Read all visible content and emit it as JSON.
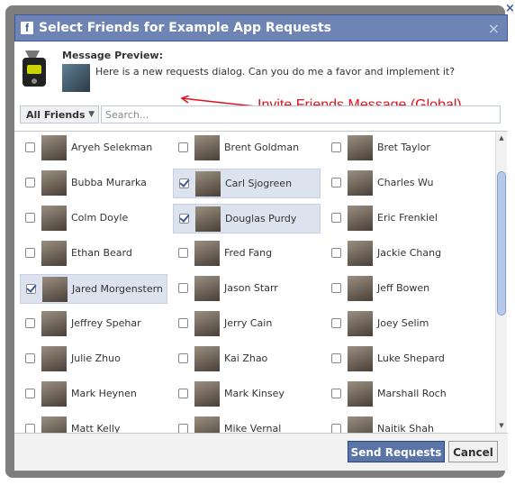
{
  "dialog": {
    "title": "Select Friends for Example App Requests",
    "logo_letter": "f",
    "close_symbol": "×",
    "corner_close_symbol": "×"
  },
  "preview": {
    "label": "Message Preview:",
    "message": "Here is a new requests dialog. Can you do me a favor and implement it?"
  },
  "annotation": {
    "text": "Invite Friends Message (Global)",
    "color": "#e0121a"
  },
  "filter": {
    "selected": "All Friends",
    "search_placeholder": "Search..."
  },
  "friends": [
    {
      "name": "Aryeh Selekman",
      "checked": false
    },
    {
      "name": "Brent Goldman",
      "checked": false
    },
    {
      "name": "Bret Taylor",
      "checked": false
    },
    {
      "name": "Bubba Murarka",
      "checked": false
    },
    {
      "name": "Carl Sjogreen",
      "checked": true
    },
    {
      "name": "Charles Wu",
      "checked": false
    },
    {
      "name": "Colm Doyle",
      "checked": false
    },
    {
      "name": "Douglas Purdy",
      "checked": true
    },
    {
      "name": "Eric Frenkiel",
      "checked": false
    },
    {
      "name": "Ethan Beard",
      "checked": false
    },
    {
      "name": "Fred Fang",
      "checked": false
    },
    {
      "name": "Jackie Chang",
      "checked": false
    },
    {
      "name": "Jared Morgenstern",
      "checked": true
    },
    {
      "name": "Jason Starr",
      "checked": false
    },
    {
      "name": "Jeff Bowen",
      "checked": false
    },
    {
      "name": "Jeffrey Spehar",
      "checked": false
    },
    {
      "name": "Jerry Cain",
      "checked": false
    },
    {
      "name": "Joey Selim",
      "checked": false
    },
    {
      "name": "Julie Zhuo",
      "checked": false
    },
    {
      "name": "Kai Zhao",
      "checked": false
    },
    {
      "name": "Luke Shepard",
      "checked": false
    },
    {
      "name": "Mark Heynen",
      "checked": false
    },
    {
      "name": "Mark Kinsey",
      "checked": false
    },
    {
      "name": "Marshall Roch",
      "checked": false
    },
    {
      "name": "Matt Kelly",
      "checked": false
    },
    {
      "name": "Mike Vernal",
      "checked": false
    },
    {
      "name": "Naitik Shah",
      "checked": false
    }
  ],
  "footer": {
    "send_label": "Send Requests",
    "cancel_label": "Cancel"
  },
  "colors": {
    "title_bar": "#6d84b4",
    "primary_button": "#5b74a8",
    "selected_row": "#dce3ee"
  }
}
